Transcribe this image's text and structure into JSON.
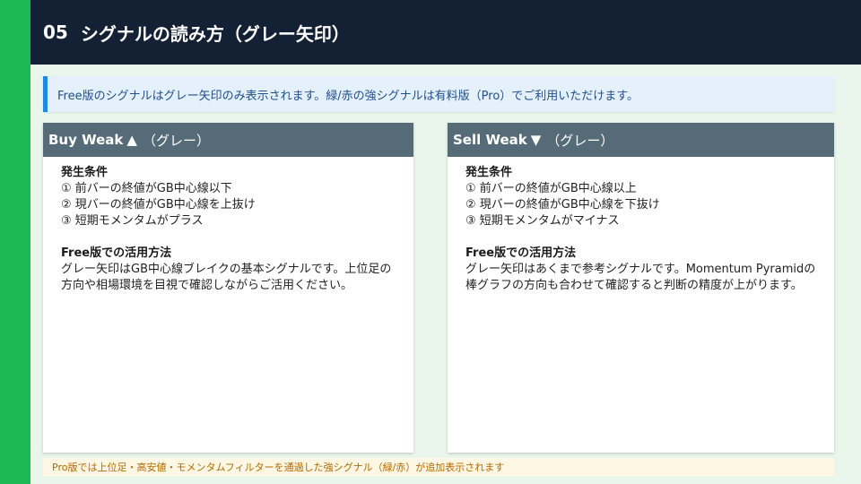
{
  "header": {
    "number": "05",
    "title": "シグナルの読み方（グレー矢印）"
  },
  "notice": "Free版のシグナルはグレー矢印のみ表示されます。緑/赤の強シグナルは有料版（Pro）でご利用いただけます。",
  "cards": [
    {
      "title": "Buy Weak",
      "symbol": "▲",
      "color_label": "（グレー）",
      "conditions_title": "発生条件",
      "conditions": [
        "① 前バーの終値がGB中心線以下",
        "② 現バーの終値がGB中心線を上抜け",
        "③ 短期モメンタムがプラス"
      ],
      "usage_title": "Free版での活用方法",
      "usage_text": "グレー矢印はGB中心線ブレイクの基本シグナルです。上位足の方向や相場環境を目視で確認しながらご活用ください。"
    },
    {
      "title": "Sell Weak",
      "symbol": "▼",
      "color_label": "（グレー）",
      "conditions_title": "発生条件",
      "conditions": [
        "① 前バーの終値がGB中心線以上",
        "② 現バーの終値がGB中心線を下抜け",
        "③ 短期モメンタムがマイナス"
      ],
      "usage_title": "Free版での活用方法",
      "usage_text": "グレー矢印はあくまで参考シグナルです。Momentum Pyramidの棒グラフの方向も合わせて確認すると判断の精度が上がります。"
    }
  ],
  "footer": "Pro版では上位足・高安値・モメンタムフィルターを通過した強シグナル（緑/赤）が追加表示されます",
  "colors": {
    "accent_green": "#1db954",
    "header_bg": "#142033",
    "notice_border": "#1e88e5",
    "card_header": "#566b78",
    "footer_text": "#b26a00"
  }
}
